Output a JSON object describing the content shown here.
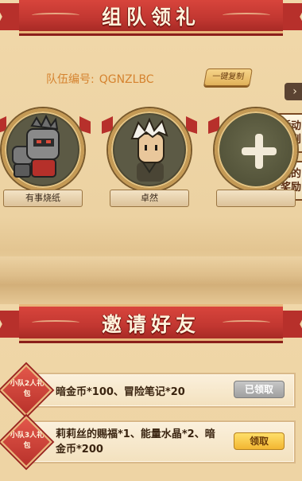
{
  "header": {
    "title": "组队领礼"
  },
  "team": {
    "id_label": "队伍编号:",
    "id_value": "QGNZLBC",
    "copy_label": "一键复制"
  },
  "side_tabs": {
    "arrow": "›",
    "rules": "活动规则",
    "rewards": "我的奖励"
  },
  "members": [
    {
      "name": "有事烧纸"
    },
    {
      "name": "卓然"
    },
    {
      "name": ""
    }
  ],
  "invite": {
    "title": "邀请好友"
  },
  "rewards": [
    {
      "badge": "小队2人礼包",
      "desc": "暗金币*100、冒险笔记*20",
      "button": "已领取",
      "state": "claimed"
    },
    {
      "badge": "小队3人礼包",
      "desc": "莉莉丝的赐福*1、能量水晶*2、暗金币*200",
      "button": "领取",
      "state": "available"
    }
  ],
  "colors": {
    "ribbon": "#c23731",
    "accent_gold": "#e9b57a",
    "team_id_text": "#d5832f"
  }
}
